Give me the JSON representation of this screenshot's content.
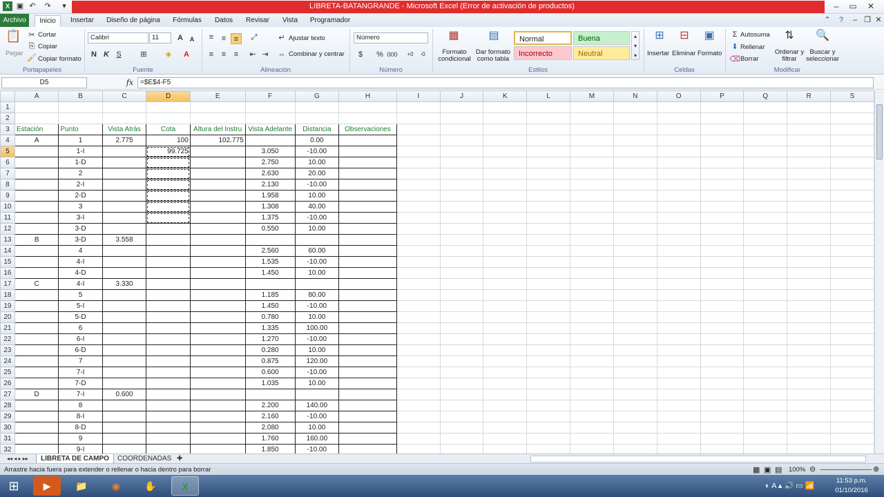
{
  "window": {
    "title": "LIBRETA-BATANGRANDE - Microsoft Excel (Error de activación de productos)"
  },
  "ribbon_tabs": [
    "Archivo",
    "Inicio",
    "Insertar",
    "Diseño de página",
    "Fórmulas",
    "Datos",
    "Revisar",
    "Vista",
    "Programador"
  ],
  "clipboard": {
    "paste": "Pegar",
    "cut": "Cortar",
    "copy": "Copiar",
    "format_painter": "Copiar formato",
    "group": "Portapapeles"
  },
  "font": {
    "name": "Calibri",
    "size": "11",
    "group": "Fuente"
  },
  "alignment": {
    "wrap": "Ajustar texto",
    "merge": "Combinar y centrar",
    "group": "Alineación"
  },
  "number": {
    "format": "Número",
    "group": "Número"
  },
  "styles": {
    "conditional": "Formato condicional",
    "as_table": "Dar formato como tabla",
    "normal": "Normal",
    "good": "Buena",
    "bad": "Incorrecto",
    "neutral": "Neutral",
    "group": "Estilos"
  },
  "cells": {
    "insert": "Insertar",
    "delete": "Eliminar",
    "format": "Formato",
    "group": "Celdas"
  },
  "editing": {
    "autosum": "Autosuma",
    "fill": "Rellenar",
    "clear": "Borrar",
    "sort": "Ordenar y filtrar",
    "find": "Buscar y seleccionar",
    "group": "Modificar"
  },
  "formula_bar": {
    "name_box": "D5",
    "formula": "=$E$4-F5"
  },
  "columns": [
    "A",
    "B",
    "C",
    "D",
    "E",
    "F",
    "G",
    "H",
    "I",
    "J",
    "K",
    "L",
    "M",
    "N",
    "O",
    "P",
    "Q",
    "R",
    "S"
  ],
  "headers": [
    "Estación",
    "Punto",
    "Vista Atrás",
    "Cota",
    "Altura del Instru",
    "Vista Adelante",
    "Distancia",
    "Observaciones"
  ],
  "rows": [
    {
      "n": "1",
      "v": [
        "",
        "",
        "",
        "",
        "",
        "",
        "",
        ""
      ]
    },
    {
      "n": "2",
      "v": [
        "",
        "",
        "",
        "",
        "",
        "",
        "",
        ""
      ]
    },
    {
      "n": "4",
      "v": [
        "A",
        "1",
        "2.775",
        "100",
        "102.775",
        "",
        "0.00",
        ""
      ]
    },
    {
      "n": "5",
      "v": [
        "",
        "1-I",
        "",
        "99.725",
        "",
        "3.050",
        "-10.00",
        ""
      ]
    },
    {
      "n": "6",
      "v": [
        "",
        "1-D",
        "",
        "",
        "",
        "2.750",
        "10.00",
        ""
      ]
    },
    {
      "n": "7",
      "v": [
        "",
        "2",
        "",
        "",
        "",
        "2.630",
        "20.00",
        ""
      ]
    },
    {
      "n": "8",
      "v": [
        "",
        "2-I",
        "",
        "",
        "",
        "2.130",
        "-10.00",
        ""
      ]
    },
    {
      "n": "9",
      "v": [
        "",
        "2-D",
        "",
        "",
        "",
        "1.958",
        "10.00",
        ""
      ]
    },
    {
      "n": "10",
      "v": [
        "",
        "3",
        "",
        "",
        "",
        "1.308",
        "40.00",
        ""
      ]
    },
    {
      "n": "11",
      "v": [
        "",
        "3-I",
        "",
        "",
        "",
        "1.375",
        "-10.00",
        ""
      ]
    },
    {
      "n": "12",
      "v": [
        "",
        "3-D",
        "",
        "",
        "",
        "0.550",
        "10.00",
        ""
      ]
    },
    {
      "n": "13",
      "v": [
        "B",
        "3-D",
        "3.558",
        "",
        "",
        "",
        "",
        ""
      ]
    },
    {
      "n": "14",
      "v": [
        "",
        "4",
        "",
        "",
        "",
        "2.560",
        "60.00",
        ""
      ]
    },
    {
      "n": "15",
      "v": [
        "",
        "4-I",
        "",
        "",
        "",
        "1.535",
        "-10.00",
        ""
      ]
    },
    {
      "n": "16",
      "v": [
        "",
        "4-D",
        "",
        "",
        "",
        "1.450",
        "10.00",
        ""
      ]
    },
    {
      "n": "17",
      "v": [
        "C",
        "4-I",
        "3.330",
        "",
        "",
        "",
        "",
        ""
      ]
    },
    {
      "n": "18",
      "v": [
        "",
        "5",
        "",
        "",
        "",
        "1.185",
        "80.00",
        ""
      ]
    },
    {
      "n": "19",
      "v": [
        "",
        "5-I",
        "",
        "",
        "",
        "1.450",
        "-10.00",
        ""
      ]
    },
    {
      "n": "20",
      "v": [
        "",
        "5-D",
        "",
        "",
        "",
        "0.780",
        "10.00",
        ""
      ]
    },
    {
      "n": "21",
      "v": [
        "",
        "6",
        "",
        "",
        "",
        "1.335",
        "100.00",
        ""
      ]
    },
    {
      "n": "22",
      "v": [
        "",
        "6-I",
        "",
        "",
        "",
        "1.270",
        "-10.00",
        ""
      ]
    },
    {
      "n": "23",
      "v": [
        "",
        "6-D",
        "",
        "",
        "",
        "0.280",
        "10.00",
        ""
      ]
    },
    {
      "n": "24",
      "v": [
        "",
        "7",
        "",
        "",
        "",
        "0.875",
        "120.00",
        ""
      ]
    },
    {
      "n": "25",
      "v": [
        "",
        "7-I",
        "",
        "",
        "",
        "0.600",
        "-10.00",
        ""
      ]
    },
    {
      "n": "26",
      "v": [
        "",
        "7-D",
        "",
        "",
        "",
        "1.035",
        "10.00",
        ""
      ]
    },
    {
      "n": "27",
      "v": [
        "D",
        "7-I",
        "0.600",
        "",
        "",
        "",
        "",
        ""
      ]
    },
    {
      "n": "28",
      "v": [
        "",
        "8",
        "",
        "",
        "",
        "2.200",
        "140.00",
        ""
      ]
    },
    {
      "n": "29",
      "v": [
        "",
        "8-I",
        "",
        "",
        "",
        "2.160",
        "-10.00",
        ""
      ]
    },
    {
      "n": "30",
      "v": [
        "",
        "8-D",
        "",
        "",
        "",
        "2.080",
        "10.00",
        ""
      ]
    },
    {
      "n": "31",
      "v": [
        "",
        "9",
        "",
        "",
        "",
        "1.760",
        "160.00",
        ""
      ]
    },
    {
      "n": "32",
      "v": [
        "",
        "9-I",
        "",
        "",
        "",
        "1.850",
        "-10.00",
        ""
      ]
    }
  ],
  "sheets": [
    "LIBRETA DE CAMPO",
    "COORDENADAS"
  ],
  "status": {
    "message": "Arrastre hacia fuera para extender o rellenar o hacia dentro para borrar",
    "zoom": "100%"
  },
  "clock": {
    "time": "11:53 p.m.",
    "date": "01/10/2016"
  },
  "colors": {
    "accent": "#2a7a3a",
    "title_band": "#e02c2c",
    "header_text": "#1e7d32",
    "selected_col": "#f1c15f"
  }
}
